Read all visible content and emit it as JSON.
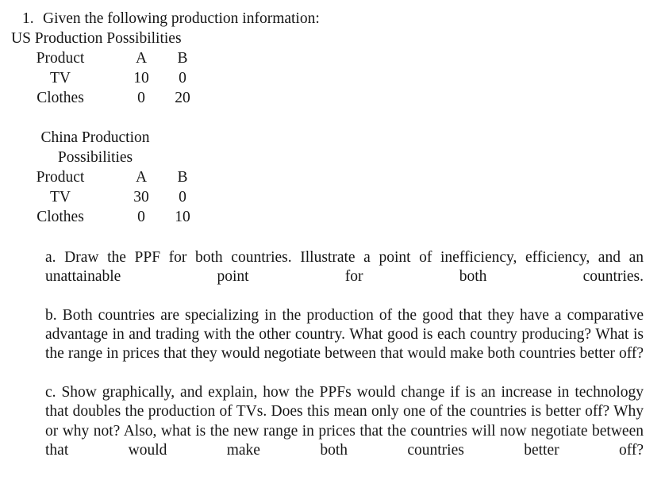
{
  "document": {
    "question_number": "1.",
    "question_text": "Given the following production information:",
    "tables": [
      {
        "caption_lines": [
          "US Production Possibilities"
        ],
        "caption_style": "left",
        "headers": [
          "Product",
          "A",
          "B"
        ],
        "rows": [
          {
            "product": "TV",
            "a": "10",
            "b": "0"
          },
          {
            "product": "Clothes",
            "a": "0",
            "b": "20"
          }
        ]
      },
      {
        "caption_lines": [
          "China Production",
          "Possibilities"
        ],
        "caption_style": "center",
        "headers": [
          "Product",
          "A",
          "B"
        ],
        "rows": [
          {
            "product": "TV",
            "a": "30",
            "b": "0"
          },
          {
            "product": "Clothes",
            "a": "0",
            "b": "10"
          }
        ]
      }
    ],
    "sub_questions": [
      {
        "label": "a.",
        "text": "a. Draw the PPF for both countries. Illustrate a point of inefficiency, efficiency, and an unattainable point for both countries."
      },
      {
        "label": "b.",
        "text": "b. Both countries are specializing in the production of the good that they have a comparative advantage in and trading with the other country. What good is each country producing? What is the range in prices that they would negotiate between that would make both countries better off?"
      },
      {
        "label": "c.",
        "text": "c. Show graphically, and explain, how the PPFs would change if is an increase in technology that doubles the production of TVs. Does this mean only one of the countries is better off? Why or why not? Also, what is the new range in prices that the countries will now negotiate between that would make both countries better off?"
      }
    ]
  },
  "colors": {
    "page_background": "#ffffff",
    "text": "#161616"
  }
}
